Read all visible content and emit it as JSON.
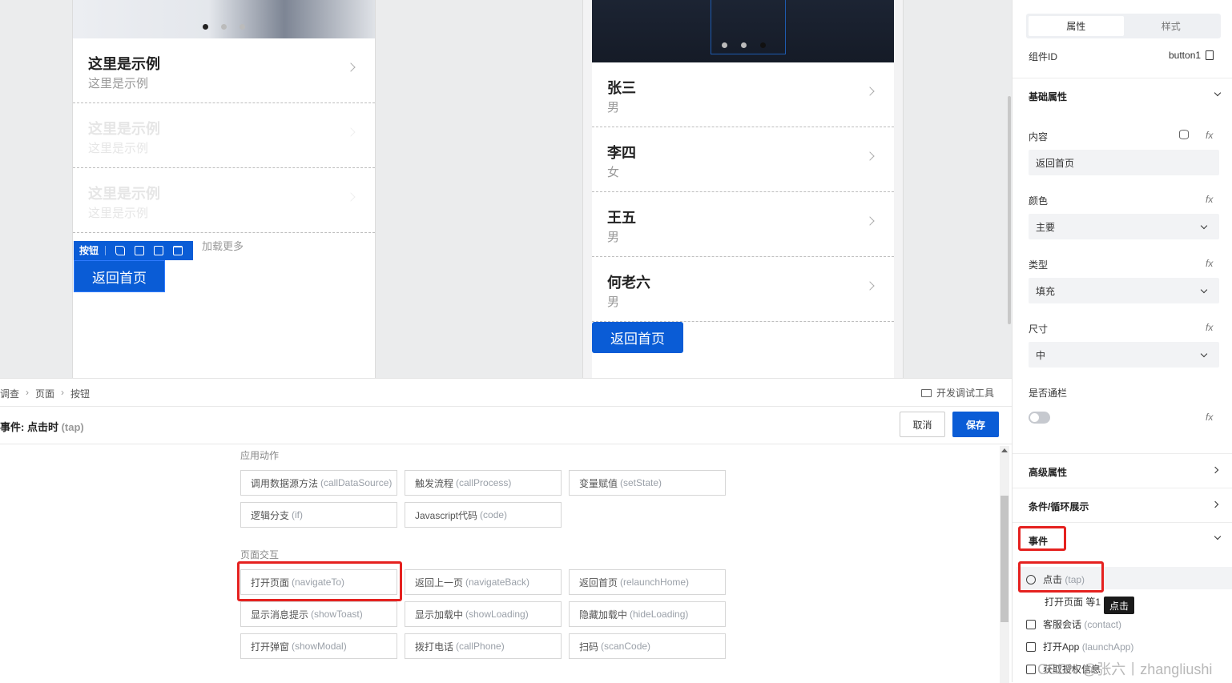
{
  "canvas": {
    "left_list": [
      {
        "title": "这里是示例",
        "sub": "这里是示例"
      },
      {
        "title": "这里是示例",
        "sub": "这里是示例"
      },
      {
        "title": "这里是示例",
        "sub": "这里是示例"
      }
    ],
    "load_more": "加载更多",
    "toolbar_label": "按钮",
    "home_button": "返回首页",
    "right_list": [
      {
        "title": "张三",
        "sub": "男"
      },
      {
        "title": "李四",
        "sub": "女"
      },
      {
        "title": "王五",
        "sub": "男"
      },
      {
        "title": "何老六",
        "sub": "男"
      }
    ],
    "home_button_right": "返回首页"
  },
  "bottom": {
    "breadcrumb": [
      "调查",
      "页面",
      "按钮"
    ],
    "devtools": "开发调试工具",
    "event_title": "事件: 点击时",
    "event_title_en": "(tap)",
    "cancel": "取消",
    "save": "保存",
    "sections": [
      {
        "title": "应用动作",
        "actions": [
          {
            "cn": "调用数据源方法",
            "en": "(callDataSource)"
          },
          {
            "cn": "触发流程",
            "en": "(callProcess)"
          },
          {
            "cn": "变量赋值",
            "en": "(setState)"
          },
          {
            "cn": "逻辑分支",
            "en": "(if)"
          },
          {
            "cn": "Javascript代码",
            "en": "(code)"
          }
        ]
      },
      {
        "title": "页面交互",
        "actions": [
          {
            "cn": "打开页面",
            "en": "(navigateTo)"
          },
          {
            "cn": "返回上一页",
            "en": "(navigateBack)"
          },
          {
            "cn": "返回首页",
            "en": "(relaunchHome)"
          },
          {
            "cn": "显示消息提示",
            "en": "(showToast)"
          },
          {
            "cn": "显示加载中",
            "en": "(showLoading)"
          },
          {
            "cn": "隐藏加载中",
            "en": "(hideLoading)"
          },
          {
            "cn": "打开弹窗",
            "en": "(showModal)"
          },
          {
            "cn": "拨打电话",
            "en": "(callPhone)"
          },
          {
            "cn": "扫码",
            "en": "(scanCode)"
          }
        ]
      }
    ]
  },
  "props": {
    "tabs": [
      "属性",
      "样式"
    ],
    "component_id_label": "组件ID",
    "component_id": "button1",
    "basic_group": "基础属性",
    "content_label": "内容",
    "content_value": "返回首页",
    "color_label": "颜色",
    "color_value": "主要",
    "type_label": "类型",
    "type_value": "填充",
    "size_label": "尺寸",
    "size_value": "中",
    "banner_label": "是否通栏",
    "fx": "fx",
    "advanced_group": "高级属性",
    "loop_group": "条件/循环展示",
    "events_group": "事件",
    "events": {
      "tap": {
        "cn": "点击",
        "en": "(tap)"
      },
      "tap_sub": "打开页面 等1",
      "contact": {
        "cn": "客服会话",
        "en": "(contact)"
      },
      "launch": {
        "cn": "打开App",
        "en": "(launchApp)"
      },
      "auth": {
        "cn": "获取授权信息",
        "en": ""
      }
    },
    "tooltip": "点击"
  },
  "watermark": "CSDN @张六丨zhangliushi",
  "colors": {
    "primary": "#0a5cd6",
    "highlight": "#e5211f"
  }
}
